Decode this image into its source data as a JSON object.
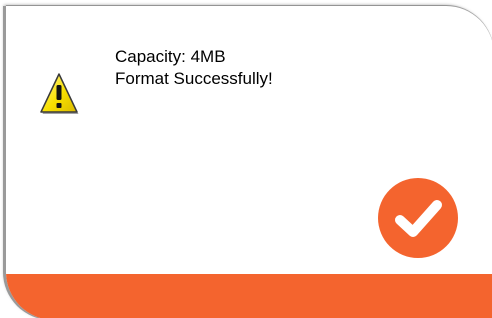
{
  "dialog": {
    "message_lines": [
      "Capacity: 4MB",
      "Format Successfully!"
    ],
    "icon": "warning-icon",
    "confirm_icon": "checkmark-icon"
  },
  "colors": {
    "accent": "#f4642e",
    "background": "#ffffff",
    "warning_fill": "#f8e000",
    "text": "#000000"
  }
}
